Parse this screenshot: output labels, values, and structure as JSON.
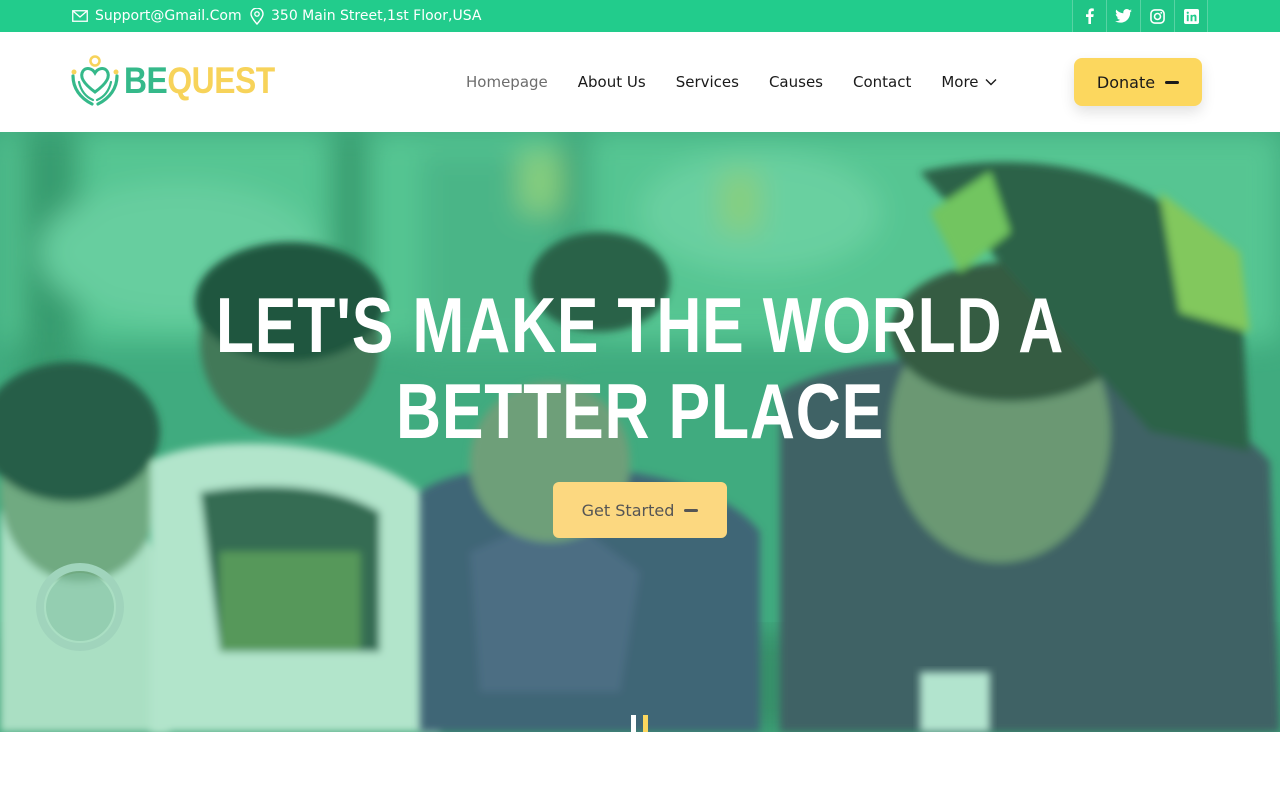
{
  "topbar": {
    "email": "Support@Gmail.Com",
    "address": "350 Main Street,1st Floor,USA",
    "social_icons": [
      "facebook-icon",
      "twitter-icon",
      "instagram-icon",
      "linkedin-icon"
    ]
  },
  "brand": {
    "logo_part1": "BE",
    "logo_part2": "QUEST"
  },
  "nav": {
    "items": [
      "Homepage",
      "About Us",
      "Services",
      "Causes",
      "Contact",
      "More"
    ],
    "active": "Homepage"
  },
  "donate_label": "Donate",
  "hero": {
    "title_line1": "LET'S MAKE THE WORLD A",
    "title_line2": "BETTER PLACE",
    "cta_label": "Get Started"
  },
  "colors": {
    "primary_green": "#22cc8c",
    "accent_yellow": "#fcd75e"
  }
}
